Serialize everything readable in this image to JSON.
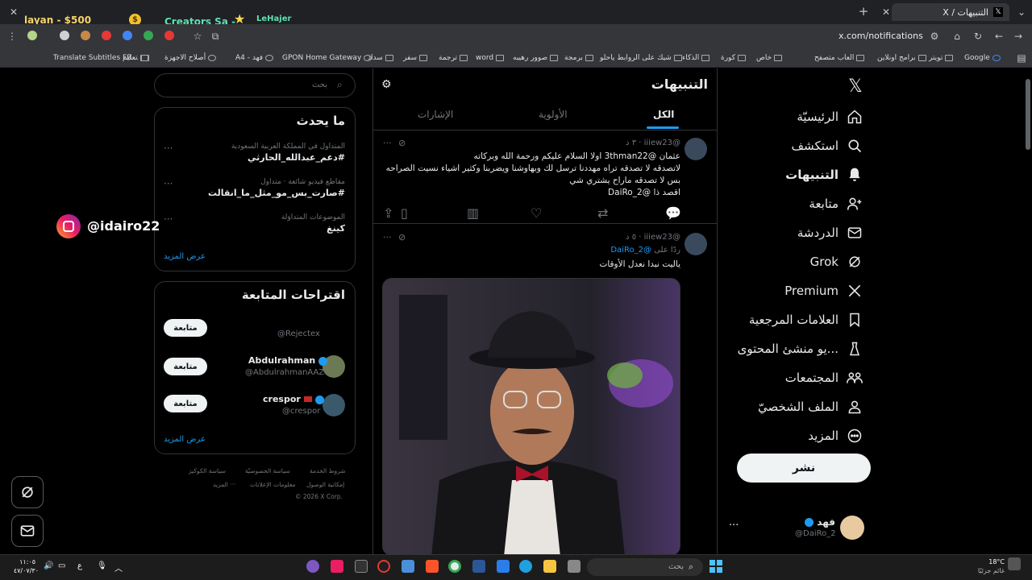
{
  "browser": {
    "tab_title": "التنبيهات / X",
    "url": "x.com/notifications",
    "new_tab": "+",
    "bookmarks": [
      "Google",
      "تويتر",
      "برامج اونلاين",
      "العاب متصفح",
      "خاص",
      "كورة",
      "الذكاء",
      "شيك على الروابط ياحلو",
      "برمجة",
      "صوور رهيبه",
      "word",
      "ترجمة",
      "سفر",
      "سداد",
      "GPON Home Gateway",
      "فهد - A4",
      "أصلاح الاجهزة",
      "تعليم",
      "Translate Subtitles FR..."
    ]
  },
  "overlay": {
    "money_label": "layan - $500",
    "creators_label": "Creators Sa -",
    "hajer_label": "LeHajer",
    "instagram_handle": "@idairo22"
  },
  "nav": {
    "items": [
      {
        "label": "الرئيسيّة",
        "icon": "home-icon"
      },
      {
        "label": "استكشف",
        "icon": "search-icon"
      },
      {
        "label": "التنبيهات",
        "icon": "bell-icon"
      },
      {
        "label": "متابعة",
        "icon": "person-plus-icon"
      },
      {
        "label": "الدردشة",
        "icon": "envelope-icon"
      },
      {
        "label": "Grok",
        "icon": "grok-icon"
      },
      {
        "label": "Premium",
        "icon": "x-logo-icon"
      },
      {
        "label": "العلامات المرجعية",
        "icon": "bookmark-icon"
      },
      {
        "label": "...يو منشئ المحتوى",
        "icon": "creator-studio-icon"
      },
      {
        "label": "المجتمعات",
        "icon": "communities-icon"
      },
      {
        "label": "الملف الشخصيّ",
        "icon": "profile-icon"
      },
      {
        "label": "المزيد",
        "icon": "more-circle-icon"
      }
    ],
    "post_button": "نشر",
    "account_name": "فهد",
    "account_handle": "@DaiRo_2"
  },
  "main": {
    "title": "التنبيهات",
    "tabs": [
      "الكل",
      "الأولوية",
      "الإشارات"
    ],
    "active_tab": "الكل",
    "tweets": [
      {
        "handle": "@iiiew23",
        "time": "٣ د",
        "lines": [
          "عثمان @3thman22 اولا السلام عليكم ورحمة الله وبركاته",
          "لاتصدقه لا تصدقه تراه مهددنا ترسل لك وبهاوشنا ويضربنا وكثير اشياء نسيت الصراحه",
          "بس لا تصدقه ماراح يشتري شي",
          "اقصد ذا @DaiRo_2"
        ]
      },
      {
        "handle": "@iiiew23",
        "time": "٥ د",
        "reply_to_prefix": "ردًا على",
        "reply_to_handle": "@DaiRo_2",
        "text": "ياليت نبدا نعدل الأوقات"
      }
    ]
  },
  "sidebar": {
    "search_placeholder": "بحث",
    "trends_title": "ما يحدث",
    "trends": [
      {
        "meta": "المتداول في المملكة العربية السعودية",
        "name": "#دعم_عبدالله_الحارثي"
      },
      {
        "meta": "مقاطع فيديو شائعة · متداول",
        "name": "#صارت_بس_مو_مثل_ما_انقالت"
      },
      {
        "meta": "الموضوعات المتداوَلة",
        "name": "كينغ"
      }
    ],
    "show_more": "عرض المزيد",
    "who_to_follow_title": "اقتراحات المتابعة",
    "suggestions": [
      {
        "name": "",
        "handle": "@Rejectex",
        "button": "متابعة"
      },
      {
        "name": "Abdulrahman",
        "handle": "@AbdulrahmanAAZ",
        "button": "متابعة"
      },
      {
        "name": "crespor",
        "handle": "@crespor",
        "button": "متابعة"
      }
    ],
    "footer_links": [
      "شروط الخدمة",
      "سياسة الخصوصيّة",
      "سياسة الكوكيز",
      "إمكانية الوصول",
      "معلومات الإعلانات",
      "··· المزيد"
    ],
    "copyright": "© 2026 X Corp."
  },
  "taskbar": {
    "search_placeholder": "بحث",
    "weather_temp": "18°C",
    "weather_desc": "غائم جزئيًا",
    "time": "١١:٠٥",
    "date": "٤٧/٠٧/٣٠",
    "lang": "ع"
  },
  "colors": {
    "accent": "#1d9bf0",
    "bg": "#000000",
    "border": "#2f3336",
    "muted": "#71767b"
  }
}
